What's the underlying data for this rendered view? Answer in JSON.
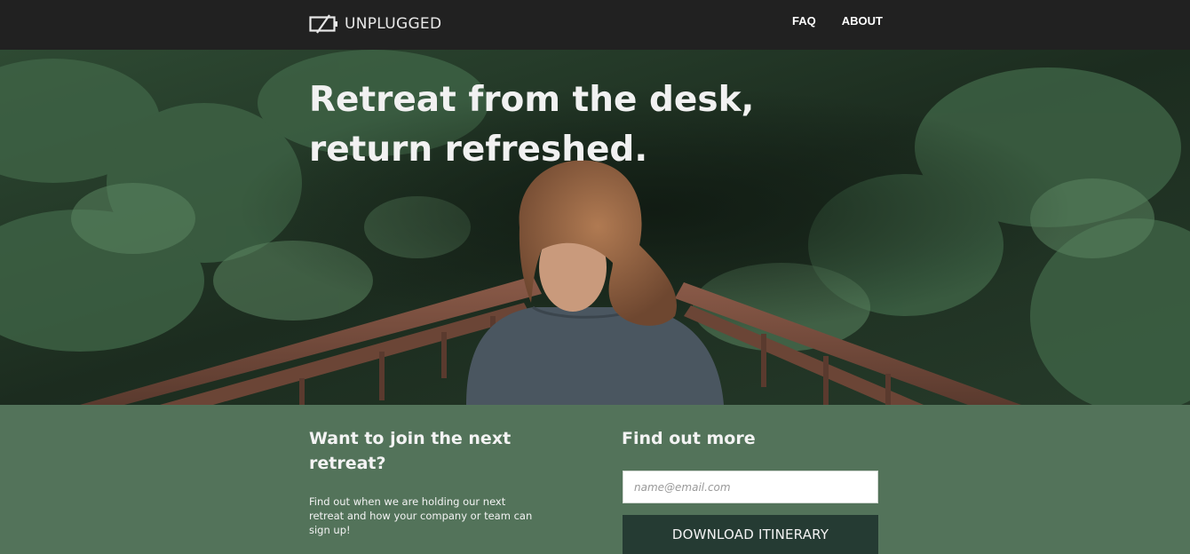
{
  "brand": {
    "name": "UNPLUGGED",
    "logo_icon": "unplugged-battery-icon"
  },
  "nav": {
    "items": [
      {
        "label": "FAQ"
      },
      {
        "label": "ABOUT"
      }
    ]
  },
  "hero": {
    "title_line1": "Retreat from the desk,",
    "title_line2": "return refreshed.",
    "image": "woman-on-forest-bridge"
  },
  "join": {
    "title": "Want to join the next retreat?",
    "text": "Find out when we are holding our next retreat and how your company or team can sign up!"
  },
  "find_more": {
    "title": "Find out more",
    "email_placeholder": "name@email.com",
    "button_label": "DOWNLOAD ITINERARY"
  },
  "colors": {
    "navbar": "#212121",
    "section_green": "#53735a",
    "button_dark": "#253b33",
    "text_light": "#f3f3f3"
  }
}
